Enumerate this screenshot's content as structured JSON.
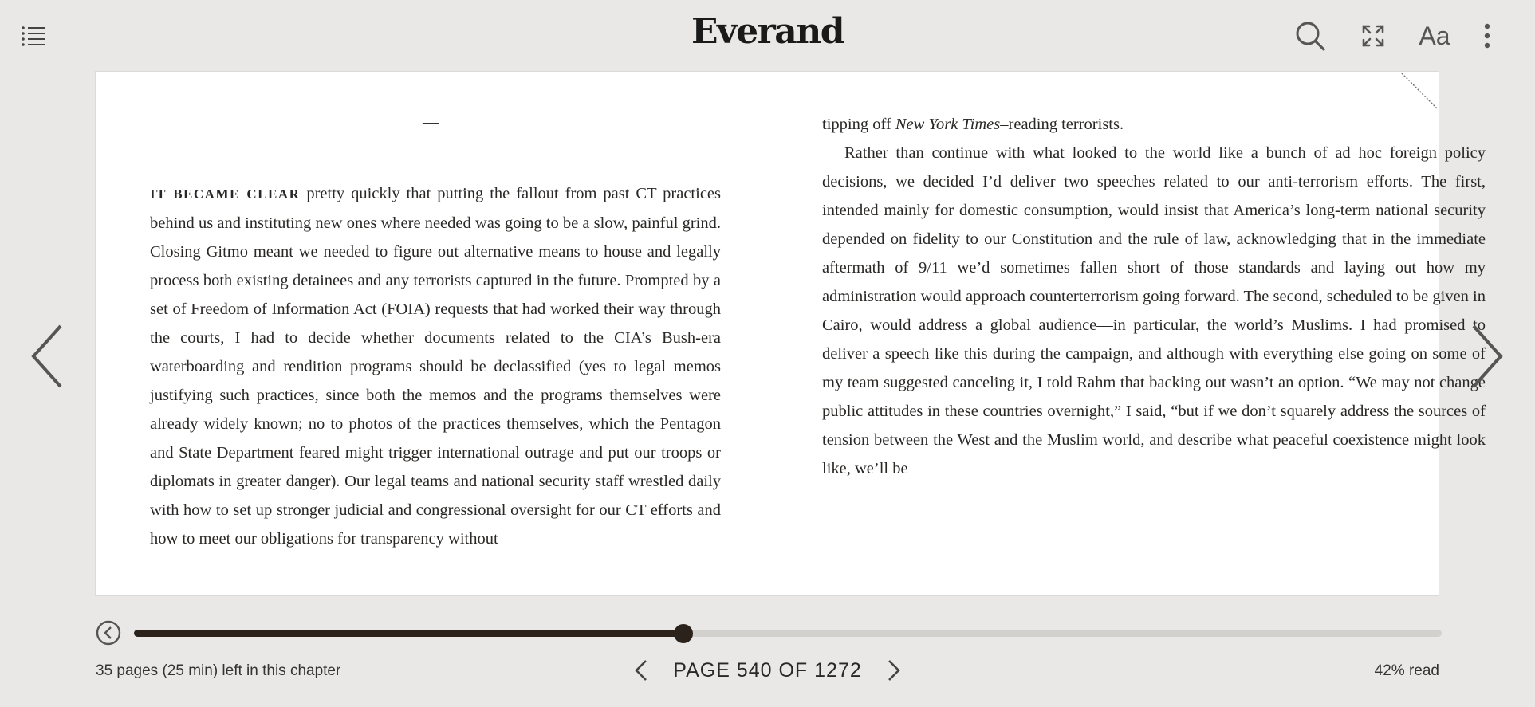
{
  "header": {
    "brand": "Everand",
    "icons": {
      "toc": "table-of-contents-icon",
      "search": "search-icon",
      "fullscreen": "fullscreen-icon",
      "font": "font-settings-icon",
      "more": "more-options-icon"
    },
    "font_label": "Aa"
  },
  "page": {
    "left_column": {
      "separator": "—",
      "lead_in": "IT BECAME CLEAR",
      "text": "pretty quickly that putting the fallout from past CT practices behind us and instituting new ones where needed was going to be a slow, painful grind. Closing Gitmo meant we needed to figure out alternative means to house and legally process both existing detainees and any terrorists captured in the future. Prompted by a set of Freedom of Information Act (FOIA) requests that had worked their way through the courts, I had to decide whether documents related to the CIA’s Bush-era waterboarding and rendition programs should be declassified (yes to legal memos justifying such practices, since both the memos and the programs themselves were already widely known; no to photos of the practices themselves, which the Pentagon and State Department feared might trigger international outrage and put our troops or diplomats in greater danger). Our legal teams and national security staff wrestled daily with how to set up stronger judicial and congressional oversight for our CT efforts and how to meet our obligations for transparency without"
    },
    "right_column": {
      "line1_pre": "tipping off",
      "line1_italic": "New York Times",
      "line1_post": "–reading terrorists.",
      "paragraph": "Rather than continue with what looked to the world like a bunch of ad hoc foreign policy decisions, we decided I’d deliver two speeches related to our anti-terrorism efforts. The first, intended mainly for domestic consumption, would insist that America’s long-term national security depended on fidelity to our Constitution and the rule of law, acknowledging that in the immediate aftermath of 9/11 we’d sometimes fallen short of those standards and laying out how my administration would approach counterterrorism going forward. The second, scheduled to be given in Cairo, would address a global audience—in particular, the world’s Muslims. I had promised to deliver a speech like this during the campaign, and although with everything else going on some of my team suggested canceling it, I told Rahm that backing out wasn’t an option. “We may not change public attitudes in these countries overnight,” I said, “but if we don’t squarely address the sources of tension between the West and the Muslim world, and describe what peaceful coexistence might look like, we’ll be"
    }
  },
  "navigation": {
    "prev_icon": "chevron-left-icon",
    "next_icon": "chevron-right-icon"
  },
  "progress": {
    "fraction_read": 0.42,
    "back_icon": "back-circle-icon"
  },
  "footer": {
    "chapter_remaining": "35 pages (25 min) left in this chapter",
    "page_label": "PAGE 540 OF 1272",
    "percent_read": "42% read"
  },
  "colors": {
    "background": "#e9e8e6",
    "page": "#ffffff",
    "progress_fill": "#2a221b",
    "progress_track": "#d3d1ce"
  }
}
